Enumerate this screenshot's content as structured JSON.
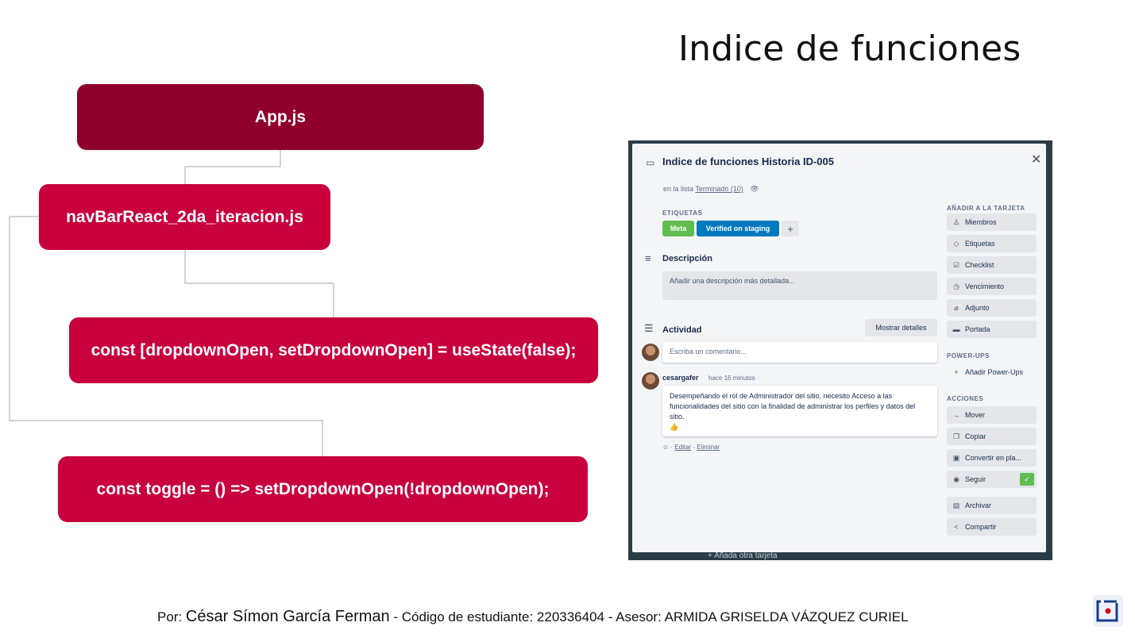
{
  "slide": {
    "title": "Indice de funciones",
    "nodes": {
      "app": "App.js",
      "nav": "navBarReact_2da_iteracion.js",
      "state": "const [dropdownOpen, setDropdownOpen] = useState(false);",
      "toggle": "const toggle = () => setDropdownOpen(!dropdownOpen);"
    },
    "footer": {
      "by": "Por:",
      "author": "César Símon García Ferman",
      "sep": " - ",
      "rest": "Código de estudiante: 220336404 - Asesor: ARMIDA GRISELDA VÁZQUEZ CURIEL"
    }
  },
  "trello": {
    "card_title": "Indice de funciones Historia ID-005",
    "in_list_prefix": "en la lista",
    "list_name": "Terminado (10)",
    "labels_heading": "ETIQUETAS",
    "labels": [
      "Meta",
      "Verified on staging"
    ],
    "add_label": "+",
    "description_heading": "Descripción",
    "description_placeholder": "Añadir una descripción más detallada...",
    "activity_heading": "Actividad",
    "show_details": "Mostrar detalles",
    "comment_placeholder": "Escriba un comentario...",
    "comment_author": "cesargafer",
    "comment_time": "hace 16 minutos",
    "comment_text": "Desempeñando el rol de Administrador del sitio, necesito Acceso a las funcionalidades del sitio con la finalidad de administrar los perfiles y datos del sitio.",
    "comment_emoji": "👍",
    "comment_edit": "Editar",
    "comment_delete": "Eliminar",
    "behind_text": "+ Añada otra tarjeta",
    "sidebar": {
      "add_heading": "AÑADIR A LA TARJETA",
      "add_items": [
        "Miembros",
        "Etiquetas",
        "Checklist",
        "Vencimiento",
        "Adjunto",
        "Portada"
      ],
      "powerups_heading": "POWER-UPS",
      "powerups_add": "Añadir Power-Ups",
      "actions_heading": "ACCIONES",
      "actions": [
        "Mover",
        "Copiar",
        "Convertir en pla...",
        "Seguir",
        "Archivar",
        "Compartir"
      ]
    },
    "colors": {
      "meta": "#61bd4f",
      "staging": "#0079bf"
    }
  }
}
